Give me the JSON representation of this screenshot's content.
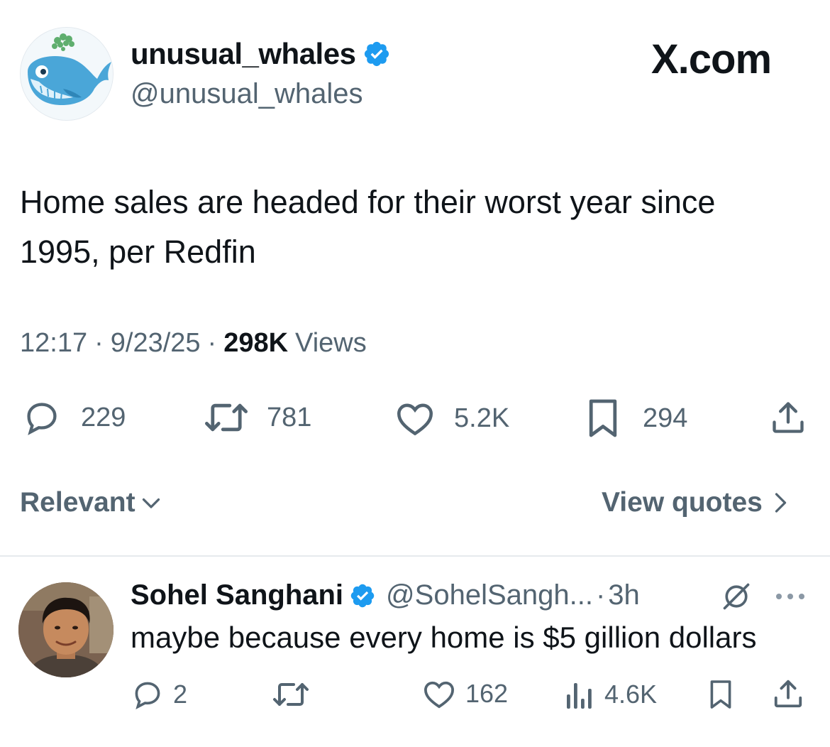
{
  "tweet": {
    "author_name": "unusual_whales",
    "author_handle": "@unusual_whales",
    "brand": "X.com",
    "text_line1": "Home sales are headed for their worst year since",
    "text_line2": "1995, per Redfin",
    "time": "12:17",
    "date": "9/23/25",
    "views_count": "298K",
    "views_label": "Views",
    "separator": "·",
    "actions": {
      "replies": "229",
      "reposts": "781",
      "likes": "5.2K",
      "bookmarks": "294"
    }
  },
  "filter": {
    "relevant_label": "Relevant",
    "view_quotes_label": "View quotes"
  },
  "reply": {
    "author_name": "Sohel Sanghani",
    "author_handle": "@SohelSangh...",
    "time": "3h",
    "separator": "·",
    "text": "maybe because every home is $5 gillion dollars",
    "actions": {
      "replies": "2",
      "likes": "162",
      "views": "4.6K"
    }
  },
  "colors": {
    "verified_blue": "#1d9bf0",
    "text_primary": "#0f1419",
    "text_secondary": "#536471",
    "divider": "#e6eaed"
  },
  "icons": [
    "verified-badge-icon",
    "reply-icon",
    "repost-icon",
    "like-icon",
    "bookmark-icon",
    "share-icon",
    "chevron-down-icon",
    "chevron-right-icon",
    "grok-icon",
    "more-icon",
    "views-icon"
  ]
}
